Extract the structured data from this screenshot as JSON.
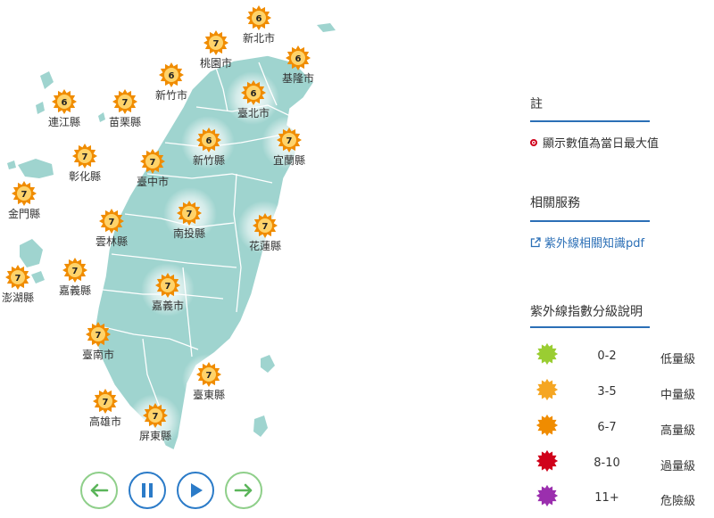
{
  "cities": [
    {
      "name": "新北市",
      "value": "6",
      "x": 0,
      "y": 0
    },
    {
      "name": "桃園市",
      "value": "7"
    },
    {
      "name": "基隆市",
      "value": "6"
    },
    {
      "name": "新竹市",
      "value": "6"
    },
    {
      "name": "臺北市",
      "value": "6"
    },
    {
      "name": "連江縣",
      "value": "6"
    },
    {
      "name": "苗栗縣",
      "value": "7"
    },
    {
      "name": "新竹縣",
      "value": "6"
    },
    {
      "name": "宜蘭縣",
      "value": "7"
    },
    {
      "name": "彰化縣",
      "value": "7"
    },
    {
      "name": "臺中市",
      "value": "7"
    },
    {
      "name": "金門縣",
      "value": "7"
    },
    {
      "name": "南投縣",
      "value": "7"
    },
    {
      "name": "雲林縣",
      "value": "7"
    },
    {
      "name": "花蓮縣",
      "value": "7"
    },
    {
      "name": "嘉義縣",
      "value": "7"
    },
    {
      "name": "澎湖縣",
      "value": "7"
    },
    {
      "name": "嘉義市",
      "value": "7"
    },
    {
      "name": "臺南市",
      "value": "7"
    },
    {
      "name": "臺東縣",
      "value": "7"
    },
    {
      "name": "高雄市",
      "value": "7"
    },
    {
      "name": "屏東縣",
      "value": "7"
    }
  ],
  "note": {
    "title": "註",
    "text": "顯示數值為當日最大值"
  },
  "services": {
    "title": "相關服務",
    "link": "紫外線相關知識pdf"
  },
  "legend": {
    "title": "紫外線指數分級說明",
    "items": [
      {
        "range": "0-2",
        "level": "低量級",
        "color": "#9acd32"
      },
      {
        "range": "3-5",
        "level": "中量級",
        "color": "#f5a623"
      },
      {
        "range": "6-7",
        "level": "高量級",
        "color": "#f08c00"
      },
      {
        "range": "8-10",
        "level": "過量級",
        "color": "#d0021b"
      },
      {
        "range": "11+",
        "level": "危險級",
        "color": "#9b2fae"
      }
    ]
  },
  "colors": {
    "map_fill": "#9fd4cf",
    "map_border": "#ffffff",
    "accent_blue": "#2b7bc8",
    "accent_green": "#8fcf8a",
    "sun_orange": "#f08c00"
  },
  "icons": {
    "prev": "arrow-left-icon",
    "pause": "pause-icon",
    "play": "play-icon",
    "next": "arrow-right-icon",
    "external": "external-link-icon"
  }
}
